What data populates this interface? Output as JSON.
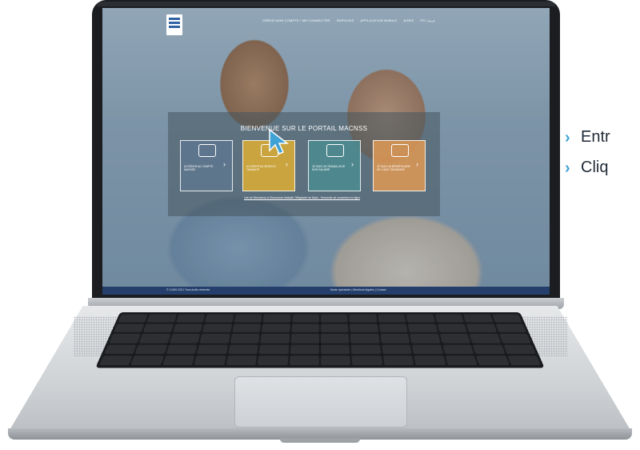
{
  "screen": {
    "nav": {
      "items": [
        "CRÉER MON COMPTE / ME CONNECTER",
        "SERVICES",
        "APPLICATION MOBILE",
        "AIDES",
        "FR | عربية"
      ]
    },
    "panel": {
      "title": "BIENVENUE SUR LE PORTAIL MACNSS",
      "cards": [
        {
          "label": "ACCÉDER AU COMPTE MACNSS",
          "icon": "user-card-icon"
        },
        {
          "label": "ACCÉDER AU SERVICE TAMANOR",
          "icon": "laptop-icon"
        },
        {
          "label": "JE SUIS UN TRAVAILLEUR NON SALARIÉ",
          "icon": "briefcase-icon"
        },
        {
          "label": "JE SUIS UN BÉNÉFICIAIRE DE L'AMO TADAMONE",
          "icon": "family-icon"
        }
      ],
      "link": "Lien de Bienvenue à l'Assurance Maladie Obligatoire de Base - Demande de couverture en ligne"
    },
    "footer": {
      "left": "© CNSS 2021 Tous droits réservés",
      "right": "Mode opératoire | Mentions légales | Contact"
    }
  },
  "steps": [
    {
      "text": "Entr"
    },
    {
      "text": "Cliq"
    }
  ],
  "colors": {
    "accent": "#3fa2d4",
    "card_yellow": "#d6aa37",
    "card_teal": "#4b8c91",
    "card_orange": "#d79655",
    "footer": "#243f6b"
  }
}
